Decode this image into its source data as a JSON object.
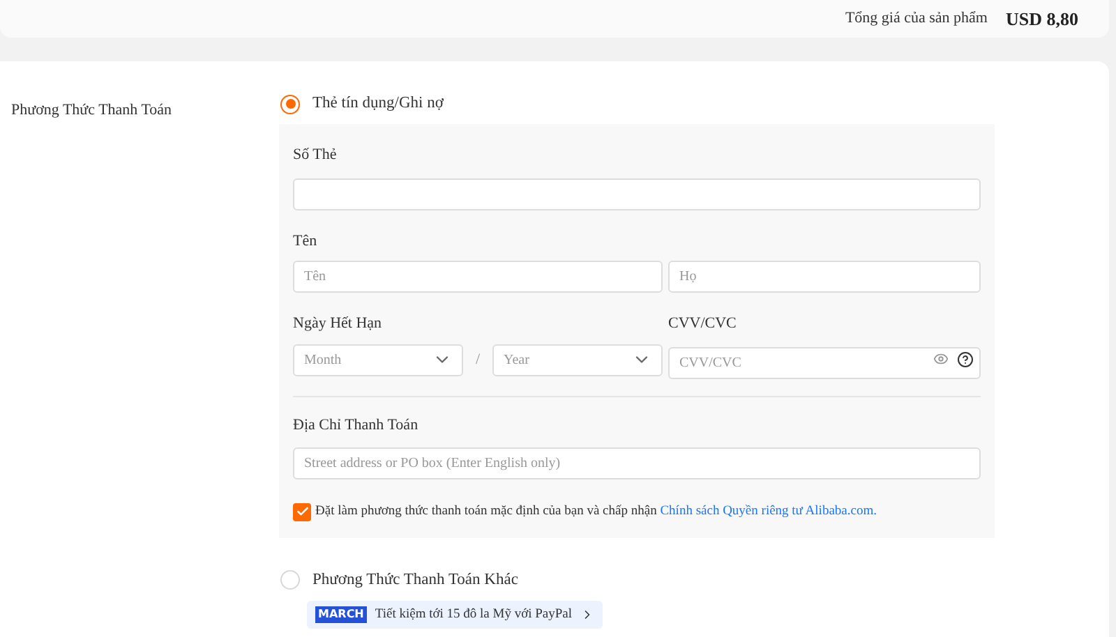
{
  "summary": {
    "label": "Tổng giá của sản phẩm",
    "price": "USD 8,80"
  },
  "section_label": "Phương Thức Thanh Toán",
  "payment_methods": [
    {
      "kind": "card",
      "label": "Thẻ tín dụng/Ghi nợ",
      "selected": true,
      "form": {
        "card_number": {
          "label": "Số Thẻ"
        },
        "name": {
          "label": "Tên",
          "first_placeholder": "Tên",
          "last_placeholder": "Họ"
        },
        "expiry": {
          "label": "Ngày Hết Hạn",
          "month_placeholder": "Month",
          "separator": "/",
          "year_placeholder": "Year"
        },
        "cvv": {
          "label": "CVV/CVC",
          "placeholder": "CVV/CVC"
        },
        "address": {
          "label": "Địa Chỉ Thanh Toán",
          "placeholder": "Street address or PO box (Enter English only)"
        },
        "default_option": {
          "checked": true,
          "text": "Đặt làm phương thức thanh toán mặc định của bạn và chấp nhận",
          "link": "Chính sách Quyền riêng tư Alibaba.com."
        }
      }
    },
    {
      "kind": "other",
      "label": "Phương Thức Thanh Toán Khác",
      "selected": false,
      "promo": {
        "badge": "MARCH",
        "text": "Tiết kiệm tới 15 đô la Mỹ với PayPal"
      }
    }
  ]
}
